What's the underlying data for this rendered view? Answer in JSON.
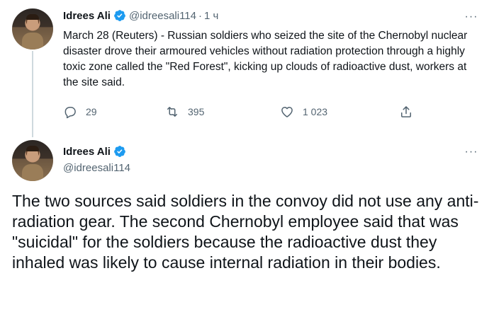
{
  "tweet1": {
    "author_name": "Idrees Ali",
    "handle": "@idreesali114",
    "separator": "·",
    "time": "1 ч",
    "text": "March 28 (Reuters) - Russian soldiers who seized the site of the Chernobyl nuclear disaster drove their armoured vehicles without radiation protection through a highly toxic zone called the \"Red Forest\", kicking up clouds of radioactive dust, workers at the site said.",
    "replies": "29",
    "retweets": "395",
    "likes": "1 023"
  },
  "tweet2": {
    "author_name": "Idrees Ali",
    "handle": "@idreesali114",
    "text": "The two sources said soldiers in the convoy did not use any anti-radiation gear. The second Chernobyl employee said that was \"suicidal\" for the soldiers because the radioactive dust they inhaled was likely to cause internal radiation in their bodies."
  },
  "icons": {
    "verified": "verified-badge-icon",
    "more": "more-icon",
    "reply": "reply-icon",
    "retweet": "retweet-icon",
    "like": "heart-icon",
    "share": "share-icon"
  },
  "colors": {
    "verified": "#1d9bf0",
    "secondary_text": "#536471",
    "primary_text": "#0f1419",
    "thread_line": "#cfd9de"
  },
  "more_glyph": "···"
}
